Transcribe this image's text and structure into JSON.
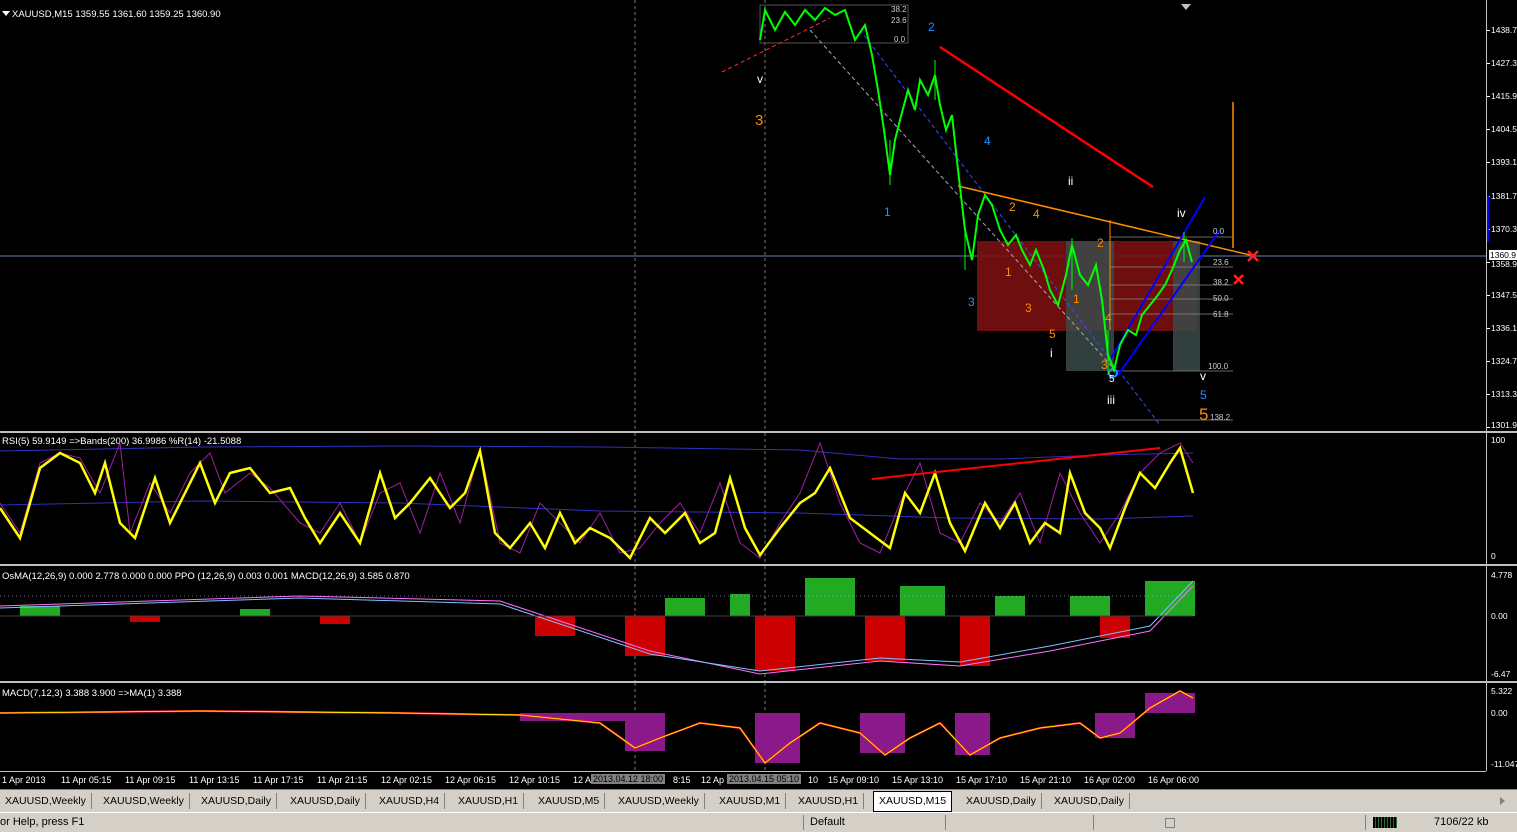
{
  "main": {
    "header": "XAUUSD,M15  1359.55 1361.60 1359.25 1360.90",
    "ticks": [
      "1438.7",
      "1427.3",
      "1415.9",
      "1404.5",
      "1393.1",
      "1381.7",
      "1370.3",
      "1358.9",
      "1347.5",
      "1336.1",
      "1324.7",
      "1313.3",
      "1301.9"
    ],
    "current_price": "1360.9",
    "fib_levels": [
      "0.0",
      "23.6",
      "38.2",
      "50.0",
      "61.8",
      "100.0",
      "138.2"
    ],
    "fib_top": [
      "38.2",
      "23.6",
      "0.0"
    ],
    "waves": {
      "w_v_top": "v",
      "w_3_orange": "3",
      "w_2_blue": "2",
      "w_4_blue": "4",
      "w_1_blue": "1",
      "w_ii": "ii",
      "w_iv": "iv",
      "w_3_blue": "3",
      "w_2_orange": "2",
      "w_4_orange": "4",
      "w_1_orange": "1",
      "w_3b_orange": "3",
      "w_5_orange": "5",
      "w_i": "i",
      "w_2b_orange": "2",
      "w_1b_orange": "1",
      "w_4b_orange": "4",
      "w_3c_orange": "3",
      "w_5b": "5",
      "w_iii": "iii",
      "w_v_bottom": "v",
      "w_5_blue": "5",
      "w_5_big": "5"
    }
  },
  "rsi": {
    "header": "RSI(5) 59.9149  =>Bands(200) 36.9986  %R(14) -21.5088",
    "ticks": [
      "100",
      "0"
    ]
  },
  "osma": {
    "header": "OsMA(12,26,9) 0.000 2.778 0.000 0.000  PPO (12,26,9) 0.003 0.001  MACD(12,26,9) 3.585 0.870",
    "ticks": [
      "4.778",
      "0.00",
      "-6.47"
    ]
  },
  "macd": {
    "header": "MACD(7,12,3) 3.388 3.900  =>MA(1) 3.388",
    "ticks": [
      "5.322",
      "0.00",
      "-11.047"
    ]
  },
  "time_labels": [
    "1 Apr 2013",
    "11 Apr 05:15",
    "11 Apr 09:15",
    "11 Apr 13:15",
    "11 Apr 17:15",
    "11 Apr 21:15",
    "12 Apr 02:15",
    "12 Apr 06:15",
    "12 Apr 10:15",
    "12 A",
    "2013.04.12 18:00",
    "8:15",
    "12 Ap",
    "2013.04.15 05:10",
    "10",
    "15 Apr 09:10",
    "15 Apr 13:10",
    "15 Apr 17:10",
    "15 Apr 21:10",
    "16 Apr 02:00",
    "16 Apr 06:00"
  ],
  "tabs": [
    "XAUUSD,Weekly",
    "XAUUSD,Weekly",
    "XAUUSD,Daily",
    "XAUUSD,Daily",
    "XAUUSD,H4",
    "XAUUSD,H1",
    "XAUUSD,M5",
    "XAUUSD,Weekly",
    "XAUUSD,M1",
    "XAUUSD,H1",
    "XAUUSD,M15",
    "XAUUSD,Daily",
    "XAUUSD,Daily"
  ],
  "status": {
    "help": "or Help, press F1",
    "profile": "Default",
    "traffic": "7106/22 kb"
  },
  "colors": {
    "candle": "#00ff00",
    "rsi": "#ffff00",
    "trend_red": "#ff0000",
    "channel": "#0000ff",
    "orange": "#ff8c00",
    "wave_blue": "#1e90ff"
  }
}
